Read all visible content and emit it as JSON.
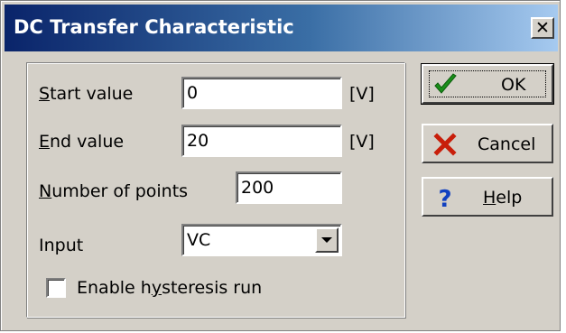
{
  "window": {
    "title": "DC Transfer Characteristic",
    "close_glyph": "✕"
  },
  "fields": {
    "start_value": {
      "label_accel": "S",
      "label_rest": "tart value",
      "value": "0",
      "unit": "[V]"
    },
    "end_value": {
      "label_accel": "E",
      "label_rest": "nd value",
      "value": "20",
      "unit": "[V]"
    },
    "number_of_points": {
      "label_accel": "N",
      "label_rest": "umber of points",
      "value": "200"
    },
    "input": {
      "label": "Input",
      "selected": "VC"
    },
    "hysteresis": {
      "label_pre": "Enable h",
      "label_accel": "y",
      "label_rest": "steresis run",
      "checked": false
    }
  },
  "buttons": {
    "ok": {
      "label": "OK",
      "icon": "checkmark-icon",
      "color": "#1a8f1a"
    },
    "cancel": {
      "label": "Cancel",
      "icon": "x-icon",
      "color": "#c81e0a"
    },
    "help": {
      "label_accel": "H",
      "label_rest": "elp",
      "icon": "question-icon",
      "color": "#1040c0"
    }
  }
}
